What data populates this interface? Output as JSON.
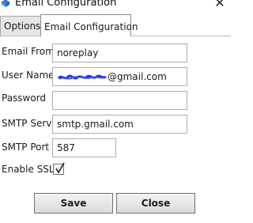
{
  "window": {
    "title": "Email Configuration",
    "icon": "envelope-config-icon",
    "close_glyph": "✕"
  },
  "tabs": [
    {
      "label": "Options",
      "active": false
    },
    {
      "label": "Email Configuration",
      "active": true
    }
  ],
  "form": {
    "email_from": {
      "label": "Email From",
      "value": "noreplay"
    },
    "user_name": {
      "label": "User Name",
      "value_suffix": "@gmail.com",
      "value_prefix_redacted": true
    },
    "password": {
      "label": "Password",
      "value": ""
    },
    "smtp_server": {
      "label": "SMTP Server",
      "value": "smtp.gmail.com"
    },
    "smtp_port": {
      "label": "SMTP Port",
      "value": "587"
    },
    "enable_ssl": {
      "label": "Enable SSL",
      "checked": true
    }
  },
  "buttons": {
    "save_label": "Save",
    "close_label": "Close"
  },
  "colors": {
    "redaction": "#2233dd",
    "checkmark": "#333333",
    "field_border": "#abadb3"
  }
}
